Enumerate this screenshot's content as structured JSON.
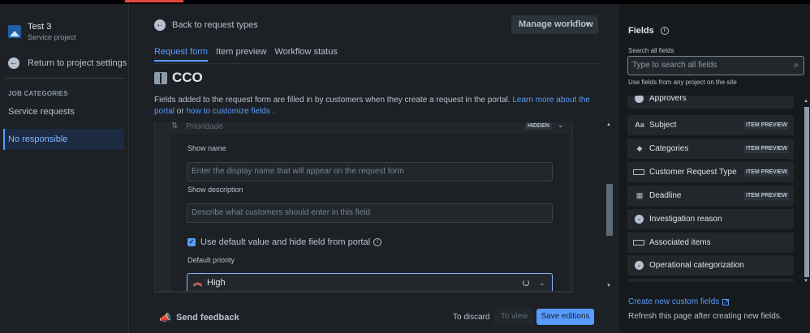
{
  "project": {
    "name": "Test 3",
    "type": "Service project"
  },
  "sidebar": {
    "back_label": "Return to project settings",
    "heading": "JOB CATEGORIES",
    "items": [
      {
        "label": "Service requests"
      },
      {
        "label": "No responsible",
        "active": true
      }
    ]
  },
  "header": {
    "back_label": "Back to request types",
    "manage_label": "Manage workflow",
    "tabs": [
      {
        "label": "Request form",
        "active": true
      },
      {
        "label": "Item preview"
      },
      {
        "label": "Workflow status"
      }
    ]
  },
  "form": {
    "title": "CCO",
    "description_text": "Fields added to the request form are filled in by customers when they create a request in the portal.",
    "learn_more_link": "Learn more about the portal",
    "or_text": "or",
    "customize_link": "how to customize fields",
    "period": "."
  },
  "field": {
    "name": "Prioridade",
    "status_badge": "HIDDEN",
    "show_name_label": "Show name",
    "show_name_placeholder": "Enter the display name that will appear on the request form",
    "show_description_label": "Show description",
    "show_description_placeholder": "Describe what customers should enter in this field",
    "checkbox_label": "Use default value and hide field from portal",
    "default_priority_label": "Default priority",
    "default_priority_value": "High"
  },
  "footer": {
    "feedback_label": "Send feedback",
    "discard_label": "To discard",
    "view_label": "To view",
    "save_label": "Save editions"
  },
  "fields_panel": {
    "title": "Fields",
    "search_label": "Search all fields",
    "search_placeholder": "Type to search all fields",
    "hint": "Use fields from any project on the site",
    "items": [
      {
        "label": "Approvers",
        "icon": "user-circle-icon",
        "badge": ""
      },
      {
        "label": "Subject",
        "icon": "text-icon",
        "badge": "ITEM PREVIEW"
      },
      {
        "label": "Categories",
        "icon": "tag-icon",
        "badge": "ITEM PREVIEW"
      },
      {
        "label": "Customer Request Type",
        "icon": "rect-icon",
        "badge": "ITEM PREVIEW"
      },
      {
        "label": "Deadline",
        "icon": "calendar-icon",
        "badge": "ITEM PREVIEW"
      },
      {
        "label": "Investigation reason",
        "icon": "chevron-circle-icon",
        "badge": ""
      },
      {
        "label": "Associated items",
        "icon": "rect-icon",
        "badge": ""
      },
      {
        "label": "Operational categorization",
        "icon": "double-chevron-circle-icon",
        "badge": ""
      }
    ],
    "create_label": "Create new custom fields",
    "refresh_text": "Refresh this page after creating new fields."
  }
}
